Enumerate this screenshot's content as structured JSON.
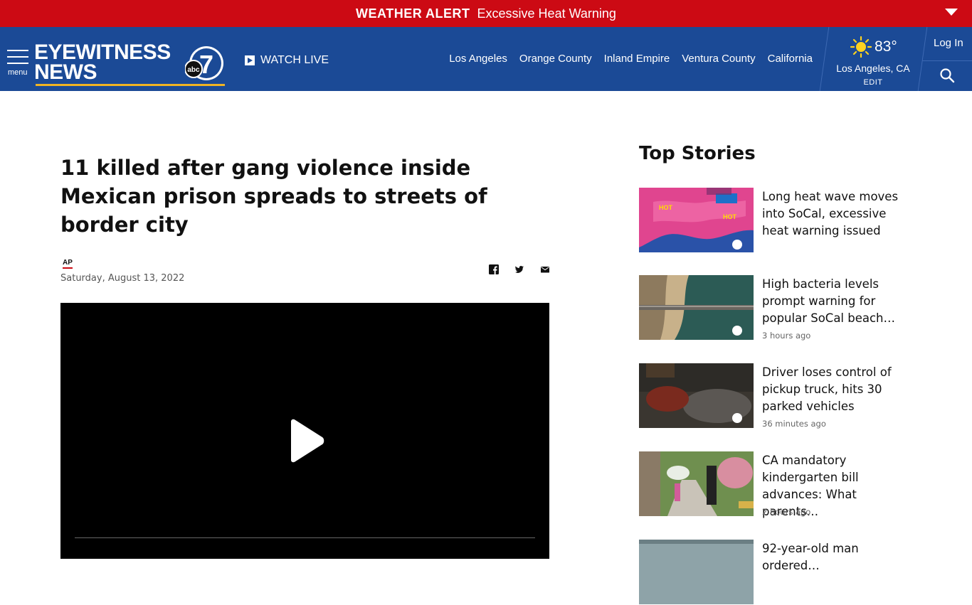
{
  "alert": {
    "title": "WEATHER ALERT",
    "text": "Excessive Heat Warning",
    "color": "#cc0a14"
  },
  "header": {
    "bg_color": "#1b4a96",
    "menu_label": "menu",
    "logo_line1": "EYEWITNESS",
    "logo_line2": "NEWS",
    "logo_abc": "abc",
    "logo_seven": "7",
    "watch_live": "WATCH LIVE",
    "nav": [
      "Los Angeles",
      "Orange County",
      "Inland Empire",
      "Ventura County",
      "California"
    ],
    "weather": {
      "icon": "sun-icon",
      "temp": "83°",
      "location": "Los Angeles, CA",
      "edit": "EDIT"
    },
    "login": "Log In",
    "search_icon": "search-icon"
  },
  "article": {
    "headline": "11 killed after gang violence inside Mexican prison spreads to streets of border city",
    "source_logo": "AP",
    "date": "Saturday, August 13, 2022",
    "share_icons": [
      "facebook-icon",
      "twitter-icon",
      "email-icon"
    ]
  },
  "sidebar": {
    "title": "Top Stories",
    "stories": [
      {
        "title": "Long heat wave moves into SoCal, excessive heat warning issued",
        "time": "",
        "thumb_label_1": "HOT",
        "thumb_label_2": "HOT"
      },
      {
        "title": "High bacteria levels prompt warning for popular SoCal beach…",
        "time": "3 hours ago"
      },
      {
        "title": "Driver loses control of pickup truck, hits 30 parked vehicles",
        "time": "36 minutes ago"
      },
      {
        "title": "CA mandatory kindergarten bill advances: What parents…",
        "time": "2 hours ago"
      },
      {
        "title": "92-year-old man ordered…",
        "time": ""
      }
    ]
  }
}
